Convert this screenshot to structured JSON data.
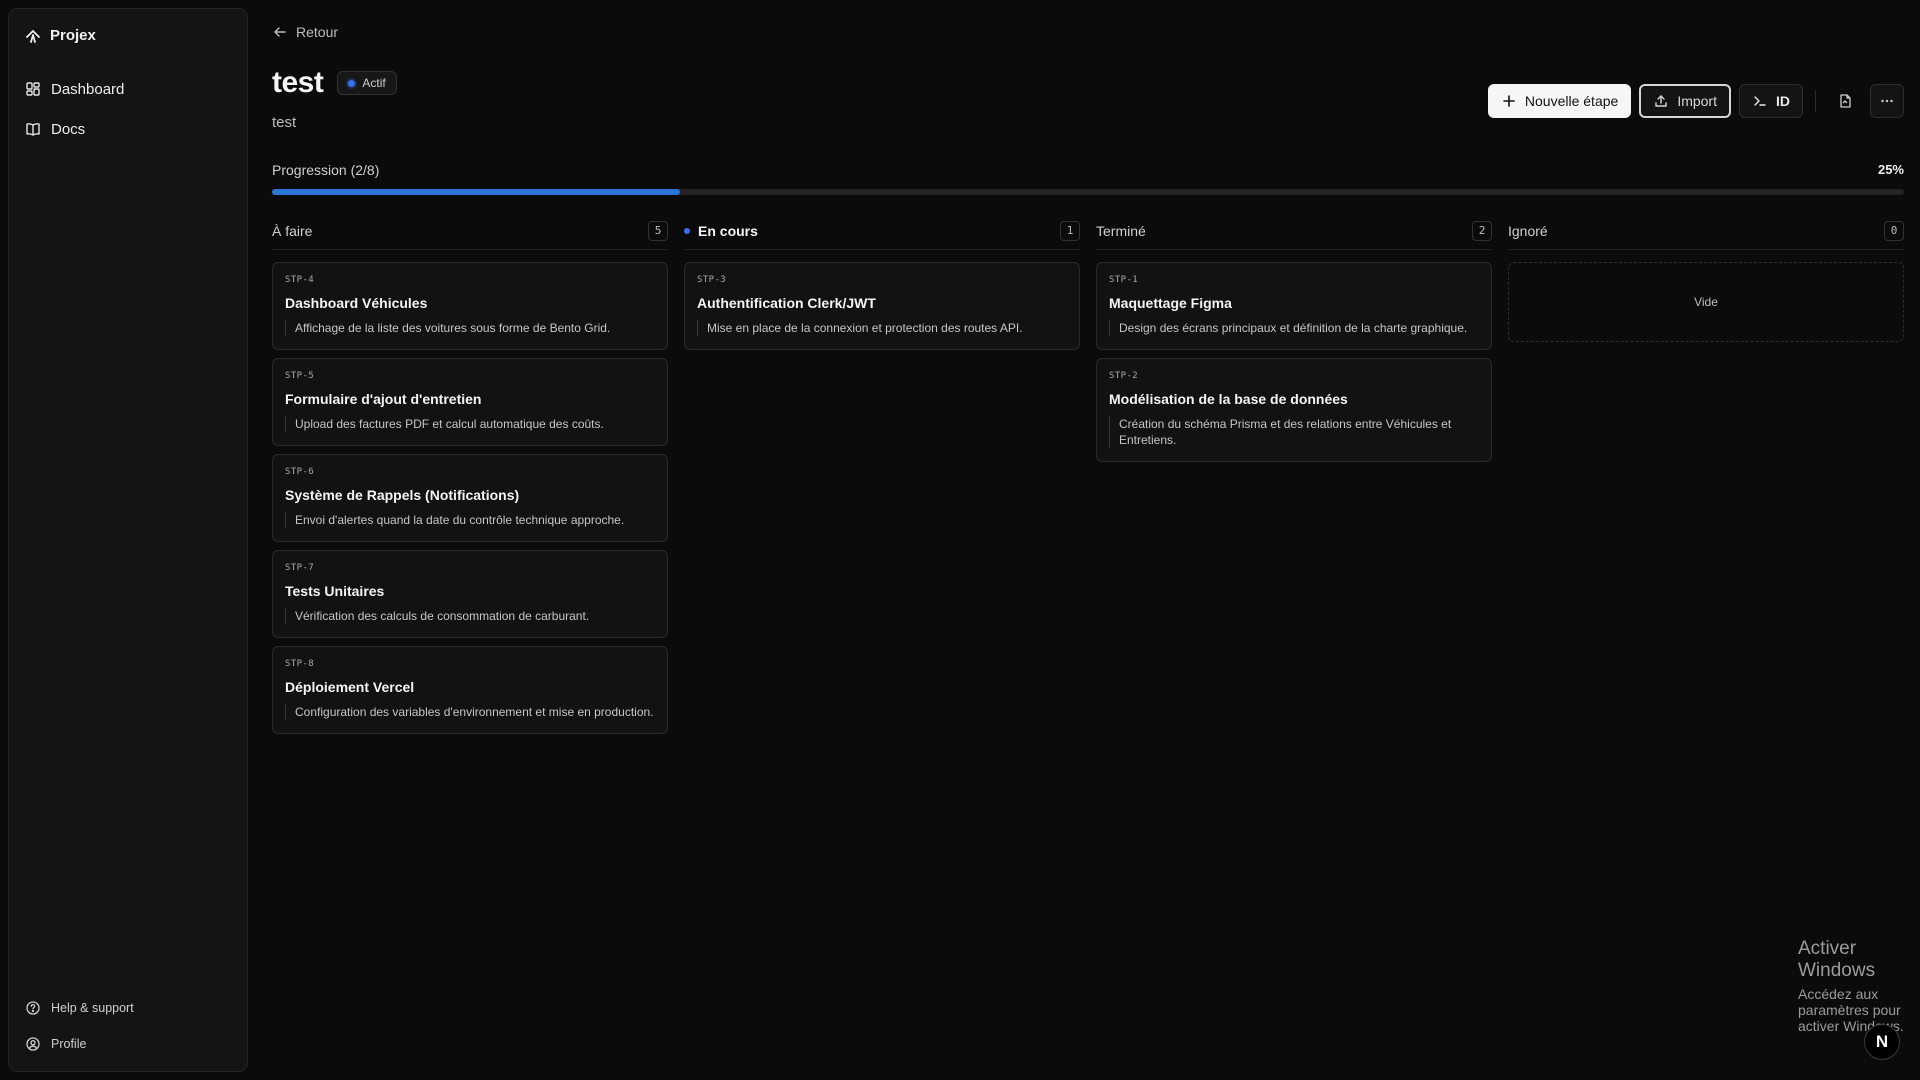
{
  "sidebar": {
    "brand": "Projex",
    "items": [
      {
        "label": "Dashboard",
        "icon": "grid-icon"
      },
      {
        "label": "Docs",
        "icon": "book-icon"
      }
    ],
    "bottom": [
      {
        "label": "Help & support",
        "icon": "help-icon"
      },
      {
        "label": "Profile",
        "icon": "user-icon"
      }
    ]
  },
  "header": {
    "back_label": "Retour",
    "title": "test",
    "status_badge": "Actif",
    "subtitle": "test"
  },
  "actions": {
    "new_step": "Nouvelle étape",
    "import": "Import",
    "id": "ID"
  },
  "progress": {
    "label": "Progression (2/8)",
    "percent_label": "25%",
    "value": 0.25,
    "color": "#2b74d8"
  },
  "columns": [
    {
      "title": "À faire",
      "count": "5",
      "cards": [
        {
          "id": "STP-4",
          "title": "Dashboard Véhicules",
          "desc": "Affichage de la liste des voitures sous forme de Bento Grid."
        },
        {
          "id": "STP-5",
          "title": "Formulaire d'ajout d'entretien",
          "desc": "Upload des factures PDF et calcul automatique des coûts."
        },
        {
          "id": "STP-6",
          "title": "Système de Rappels (Notifications)",
          "desc": "Envoi d'alertes quand la date du contrôle technique approche."
        },
        {
          "id": "STP-7",
          "title": "Tests Unitaires",
          "desc": "Vérification des calculs de consommation de carburant."
        },
        {
          "id": "STP-8",
          "title": "Déploiement Vercel",
          "desc": "Configuration des variables d'environnement et mise en production."
        }
      ]
    },
    {
      "title": "En cours",
      "count": "1",
      "cards": [
        {
          "id": "STP-3",
          "title": "Authentification Clerk/JWT",
          "desc": "Mise en place de la connexion et protection des routes API."
        }
      ]
    },
    {
      "title": "Terminé",
      "count": "2",
      "cards": [
        {
          "id": "STP-1",
          "title": "Maquettage Figma",
          "desc": "Design des écrans principaux et définition de la charte graphique."
        },
        {
          "id": "STP-2",
          "title": "Modélisation de la base de données",
          "desc": "Création du schéma Prisma et des relations entre Véhicules et Entretiens."
        }
      ]
    },
    {
      "title": "Ignoré",
      "count": "0",
      "empty_label": "Vide",
      "cards": []
    }
  ],
  "watermark": {
    "line1": "Activer Windows",
    "line2": "Accédez aux paramètres pour activer Windows."
  },
  "corner_button": "N"
}
